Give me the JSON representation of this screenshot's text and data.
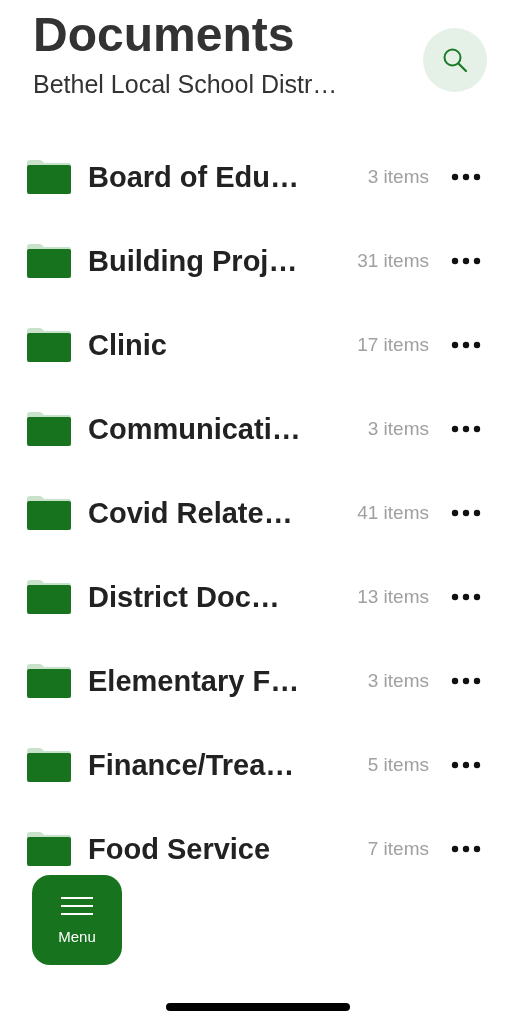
{
  "header": {
    "title": "Documents",
    "subtitle": "Bethel Local School Distr…"
  },
  "folders": [
    {
      "name": "Board of Edu…",
      "count": "3 items"
    },
    {
      "name": "Building Proj…",
      "count": "31 items"
    },
    {
      "name": "Clinic",
      "count": "17 items"
    },
    {
      "name": "Communicati…",
      "count": "3 items"
    },
    {
      "name": "Covid Relate…",
      "count": "41 items"
    },
    {
      "name": "District Doc…",
      "count": "13 items"
    },
    {
      "name": "Elementary F…",
      "count": "3 items"
    },
    {
      "name": "Finance/Trea…",
      "count": "5 items"
    },
    {
      "name": "Food Service",
      "count": "7 items"
    }
  ],
  "menu_button": {
    "label": "Menu"
  }
}
